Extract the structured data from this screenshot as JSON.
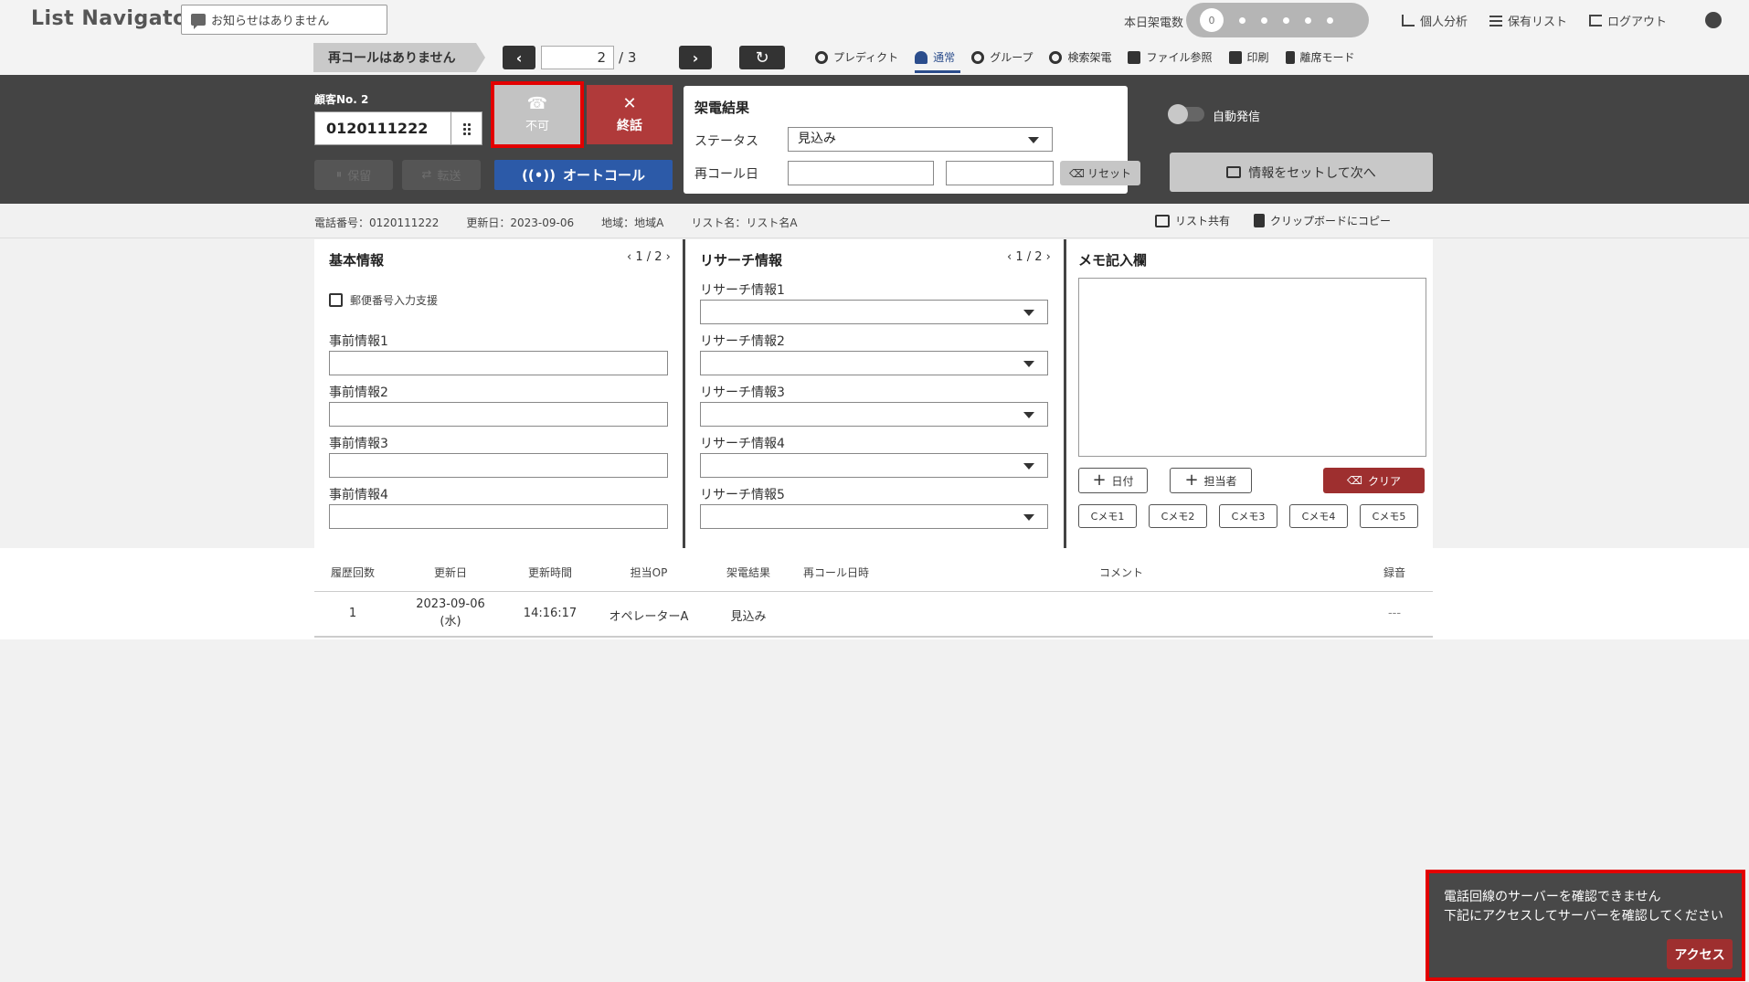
{
  "app": {
    "logo": "List Navigator."
  },
  "notice": {
    "text": "お知らせはありません"
  },
  "header": {
    "today_calls_label": "本日架電数",
    "today_calls_count": "0",
    "links": [
      "個人分析",
      "保有リスト",
      "ログアウト"
    ]
  },
  "nav": {
    "recall_tag": "再コールはありません",
    "page_value": "2",
    "page_total": "/ 3",
    "modes": [
      "プレディクト",
      "通常",
      "グループ",
      "検索架電",
      "ファイル参照",
      "印刷",
      "離席モード"
    ],
    "active_mode": "通常"
  },
  "call_panel": {
    "customer_label": "顧客No. 2",
    "phone_number": "0120111222",
    "hold_label": "保留",
    "transfer_label": "転送",
    "call_label": "不可",
    "end_label": "終話",
    "auto_call_label": "オートコール",
    "result_title": "架電結果",
    "status_label": "ステータス",
    "status_value": "見込み",
    "recall_date_label": "再コール日",
    "reset_label": "リセット",
    "auto_dial_label": "自動発信",
    "next_label": "情報をセットして次へ"
  },
  "info": {
    "phone": "電話番号：0120111222",
    "updated": "更新日：2023-09-06",
    "region": "地域：地域A",
    "list_name": "リスト名：リスト名A",
    "share": "リスト共有",
    "copy": "クリップボードにコピー"
  },
  "basic": {
    "title": "基本情報",
    "pager": "1 / 2",
    "postal": "郵便番号入力支援",
    "fields": [
      "事前情報1",
      "事前情報2",
      "事前情報3",
      "事前情報4"
    ]
  },
  "research": {
    "title": "リサーチ情報",
    "pager": "1 / 2",
    "fields": [
      "リサーチ情報1",
      "リサーチ情報2",
      "リサーチ情報3",
      "リサーチ情報4",
      "リサーチ情報5"
    ]
  },
  "memo": {
    "title": "メモ記入欄",
    "date_btn": "日付",
    "staff_btn": "担当者",
    "clear_btn": "クリア",
    "cmemos": [
      "Cメモ1",
      "Cメモ2",
      "Cメモ3",
      "Cメモ4",
      "Cメモ5"
    ]
  },
  "history": {
    "headers": [
      "履歴回数",
      "更新日",
      "更新時間",
      "担当OP",
      "架電結果",
      "再コール日時",
      "コメント",
      "録音"
    ],
    "rows": [
      {
        "count": "1",
        "date": "2023-09-06",
        "weekday": "(水)",
        "time": "14:16:17",
        "op": "オペレーターA",
        "result": "見込み",
        "recall": "",
        "comment": "",
        "recording": "---"
      }
    ]
  },
  "toast": {
    "line1": "電話回線のサーバーを確認できません",
    "line2": "下記にアクセスしてサーバーを確認してください",
    "button": "アクセス"
  },
  "colors": {
    "accent_blue": "#2c5aa8",
    "danger_red": "#b03a3a",
    "highlight": "#e30000",
    "dark_panel": "#444444"
  }
}
